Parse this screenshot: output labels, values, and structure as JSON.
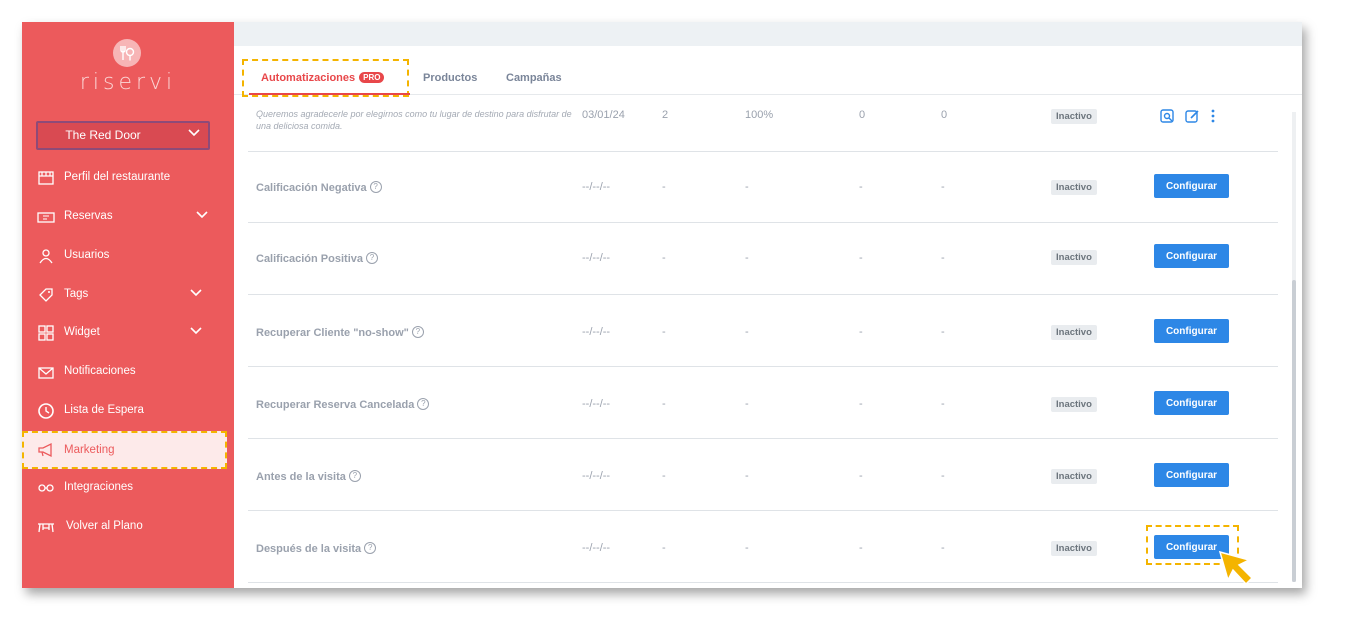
{
  "app": {
    "logo_text": "riservi",
    "restaurant_selector": "The Red Door"
  },
  "sidebar": {
    "items": [
      {
        "label": "Perfil del restaurante",
        "icon": "storefront-icon"
      },
      {
        "label": "Reservas",
        "icon": "ticket-icon",
        "expandable": true
      },
      {
        "label": "Usuarios",
        "icon": "user-icon"
      },
      {
        "label": "Tags",
        "icon": "tag-icon",
        "expandable": true
      },
      {
        "label": "Widget",
        "icon": "grid-icon",
        "expandable": true
      },
      {
        "label": "Notificaciones",
        "icon": "mail-icon"
      },
      {
        "label": "Lista de Espera",
        "icon": "clock-icon"
      },
      {
        "label": "Marketing",
        "icon": "megaphone-icon",
        "active": true
      },
      {
        "label": "Integraciones",
        "icon": "integrations-icon"
      },
      {
        "label": "Volver al Plano",
        "icon": "table-icon"
      }
    ]
  },
  "tabs": [
    {
      "label": "Automatizaciones",
      "badge": "PRO",
      "active": true
    },
    {
      "label": "Productos"
    },
    {
      "label": "Campañas"
    }
  ],
  "automations": {
    "first_row": {
      "description": "Queremos agradecerle por elegirnos como tu lugar de destino para disfrutar de una deliciosa comida.",
      "date": "03/01/24",
      "count": "2",
      "rate": "100%",
      "col4": "0",
      "col5": "0",
      "status": "Inactivo"
    },
    "rows": [
      {
        "name": "Calificación Negativa",
        "date": "--/--/--",
        "c1": "-",
        "c2": "-",
        "c3": "-",
        "c4": "-",
        "status": "Inactivo",
        "button": "Configurar"
      },
      {
        "name": "Calificación Positiva",
        "date": "--/--/--",
        "c1": "-",
        "c2": "-",
        "c3": "-",
        "c4": "-",
        "status": "Inactivo",
        "button": "Configurar"
      },
      {
        "name": "Recuperar Cliente \"no-show\"",
        "date": "--/--/--",
        "c1": "-",
        "c2": "-",
        "c3": "-",
        "c4": "-",
        "status": "Inactivo",
        "button": "Configurar"
      },
      {
        "name": "Recuperar Reserva Cancelada",
        "date": "--/--/--",
        "c1": "-",
        "c2": "-",
        "c3": "-",
        "c4": "-",
        "status": "Inactivo",
        "button": "Configurar"
      },
      {
        "name": "Antes de la visita",
        "date": "--/--/--",
        "c1": "-",
        "c2": "-",
        "c3": "-",
        "c4": "-",
        "status": "Inactivo",
        "button": "Configurar"
      },
      {
        "name": "Después de la visita",
        "date": "--/--/--",
        "c1": "-",
        "c2": "-",
        "c3": "-",
        "c4": "-",
        "status": "Inactivo",
        "button": "Configurar"
      }
    ]
  },
  "colors": {
    "sidebar": "#ec5a5c",
    "accent": "#e8474a",
    "button": "#2d87e6",
    "highlight": "#f4b400"
  }
}
